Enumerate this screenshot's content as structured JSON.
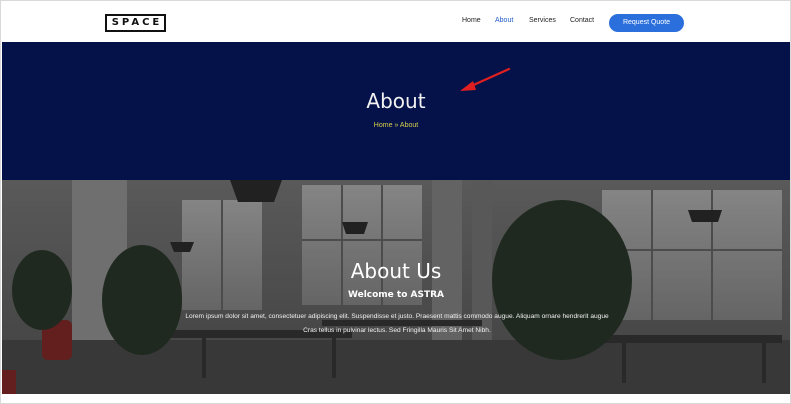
{
  "header": {
    "logo_text": "SPACE",
    "nav": [
      {
        "label": "Home",
        "active": false
      },
      {
        "label": "About",
        "active": true
      },
      {
        "label": "Services",
        "active": false
      },
      {
        "label": "Contact",
        "active": false
      }
    ],
    "cta_label": "Request Quote"
  },
  "hero": {
    "title": "About",
    "breadcrumb": {
      "home": "Home",
      "separator": "»",
      "current": "About"
    }
  },
  "about": {
    "title": "About Us",
    "subtitle": "Welcome to ASTRA",
    "body": "Lorem ipsum dolor sit amet, consectetuer adipiscing elit. Suspendisse et justo. Praesent mattis commodo augue. Aliquam ornare hendrerit augue Cras tellus in pulvinar lectus. Sed Fringilla Mauris Sit Amet Nibh."
  },
  "colors": {
    "hero_bg": "#041249",
    "accent": "#2a6fdb",
    "breadcrumb": "#d9d14a",
    "annotation_arrow": "#e02020"
  },
  "icons": [
    "red-arrow-annotation-icon"
  ]
}
